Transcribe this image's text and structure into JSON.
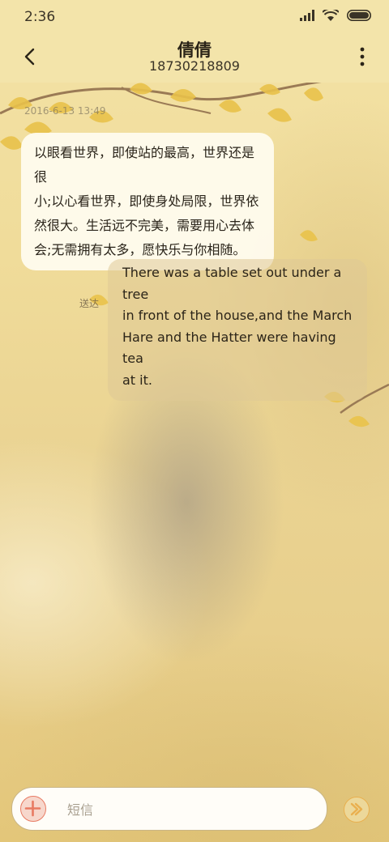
{
  "status_bar": {
    "time": "2:36",
    "icons": [
      "signal-icon",
      "wifi-icon",
      "battery-icon"
    ]
  },
  "header": {
    "contact_name": "倩倩",
    "contact_number": "18730218809",
    "back_icon": "back-arrow-icon",
    "menu_icon": "more-vertical-icon"
  },
  "conversation": {
    "timestamp": "2016-6-13 13:49",
    "messages": [
      {
        "direction": "incoming",
        "lines": [
          "以眼看世界，即使站的最高，世界还是很",
          "小;以心看世界，即使身处局限，世界依",
          "然很大。生活远不完美，需要用心去体",
          "会;无需拥有太多，愿快乐与你相随。"
        ]
      },
      {
        "direction": "outgoing",
        "lines": [
          "There was a table set out under a tree",
          "in front of the house,and the March",
          "Hare and the Hatter were having tea",
          "at it."
        ],
        "status": "送达"
      }
    ]
  },
  "composer": {
    "placeholder": "短信",
    "value": "",
    "add_icon": "plus-circle-icon",
    "send_icon": "send-icon"
  },
  "colors": {
    "accent_add": "#e87a62",
    "accent_send": "#e9b04f",
    "header_bg": "#f3e4aa"
  }
}
